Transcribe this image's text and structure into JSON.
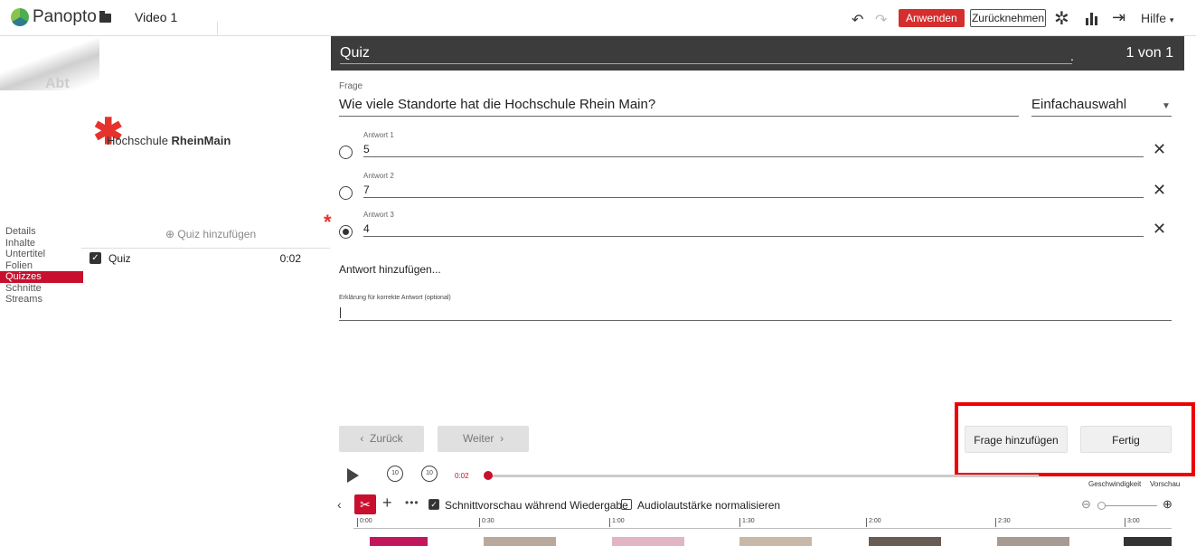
{
  "app": {
    "brand": "Panopto",
    "video_title": "Video 1"
  },
  "toolbar": {
    "apply_label": "Anwenden",
    "revert_label": "Zurücknehmen",
    "help_label": "Hilfe"
  },
  "preview": {
    "faded_text": "Abt",
    "institution_prefix": "Hochschule ",
    "institution_bold": "RheinMain"
  },
  "sidebar": {
    "nav": [
      "Details",
      "Inhalte",
      "Untertitel",
      "Folien",
      "Quizzes",
      "Schnitte",
      "Streams"
    ],
    "active": "Quizzes",
    "add_quiz_label": "Quiz hinzufügen",
    "quizzes": [
      {
        "label": "Quiz",
        "time": "0:02"
      }
    ]
  },
  "quiz": {
    "title": "Quiz",
    "dot": ".",
    "counter": "1 von 1",
    "question_label": "Frage",
    "question_text": "Wie viele Standorte hat die Hochschule Rhein Main?",
    "question_type": "Einfachauswahl",
    "answers": [
      {
        "label": "Antwort 1",
        "value": "5",
        "correct": false
      },
      {
        "label": "Antwort 2",
        "value": "7",
        "correct": false
      },
      {
        "label": "Antwort 3",
        "value": "4",
        "correct": true
      }
    ],
    "add_answer_label": "Antwort hinzufügen...",
    "explanation_label": "Erklärung für korrekte Antwort (optional)",
    "back_label": "Zurück",
    "next_label": "Weiter",
    "add_question_label": "Frage hinzufügen",
    "done_label": "Fertig"
  },
  "player": {
    "current_time": "0:02",
    "speed_label": "Geschwindigkeit",
    "preview_label": "Vorschau",
    "rewind_label": "10",
    "forward_label": "10"
  },
  "timeline": {
    "cut_preview_label": "Schnittvorschau während Wiedergabe",
    "cut_preview_checked": true,
    "normalize_label": "Audiolautstärke normalisieren",
    "normalize_checked": false,
    "ticks": [
      "0:00",
      "0:30",
      "1:00",
      "1:30",
      "2:00",
      "2:30",
      "3:00"
    ]
  },
  "colors": {
    "accent": "#c8102e",
    "header": "#3c3c3c",
    "highlight": "#e00000"
  }
}
